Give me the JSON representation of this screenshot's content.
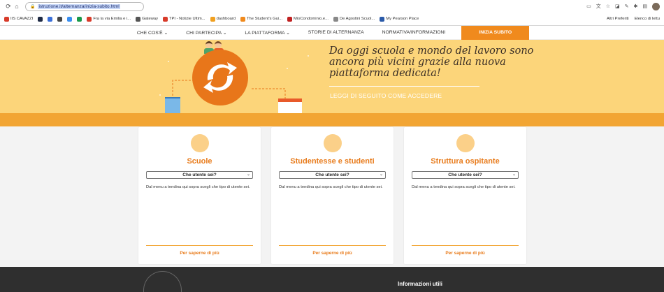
{
  "browser": {
    "url": "istruzione.it/alternanza/inizia-subito.html",
    "bookmarks": [
      {
        "label": "IIS CAVAZZI",
        "color": "#d83b2a"
      },
      {
        "label": "",
        "color": "#1f2a44"
      },
      {
        "label": "",
        "color": "#3a6fd8"
      },
      {
        "label": "",
        "color": "#444"
      },
      {
        "label": "",
        "color": "#3b8ff0"
      },
      {
        "label": "",
        "color": "#1a9a4a"
      },
      {
        "label": "Fra la via Emilia e i...",
        "color": "#d83b2a"
      },
      {
        "label": "Gateway",
        "color": "#555"
      },
      {
        "label": "TPI - Notizie Ultim...",
        "color": "#d83b2a"
      },
      {
        "label": "dashboard",
        "color": "#f0a020"
      },
      {
        "label": "The Student's Gui...",
        "color": "#f08a1d"
      },
      {
        "label": "MioCondominio.e...",
        "color": "#c02020"
      },
      {
        "label": "De Agostini Scuol...",
        "color": "#888"
      },
      {
        "label": "My Pearson Place",
        "color": "#2a5aa8"
      }
    ],
    "bookmarks_right": [
      "Altri Preferiti",
      "Elenco di lettu"
    ]
  },
  "nav": {
    "items": [
      "CHE COS'È ⌄",
      "CHI PARTECIPA ⌄",
      "LA PIATTAFORMA ⌄",
      "STORIE DI ALTERNANZA",
      "NORMATIVA/INFORMAZIONI"
    ],
    "cta": "INIZIA SUBITO"
  },
  "hero": {
    "tagline": "Da oggi scuola e mondo del lavoro sono ancora più vicini grazie alla nuova piattaforma dedicata!",
    "readmore": "LEGGI DI SEGUITO COME ACCEDERE"
  },
  "cards": [
    {
      "title": "Scuole",
      "select": "Che utente sei?",
      "text": "Dal menu a tendina qui sopra scegli che tipo di utente sei.",
      "more": "Per saperne di più"
    },
    {
      "title": "Studentesse e studenti",
      "select": "Che utente sei?",
      "text": "Dal menu a tendina qui sopra scegli che tipo di utente sei.",
      "more": "Per saperne di più"
    },
    {
      "title": "Struttura ospitante",
      "select": "Che utente sei?",
      "text": "Dal menu a tendina qui sopra scegli che tipo di utente sei.",
      "more": "Per saperne di più"
    }
  ],
  "footer": {
    "info": "Informazioni utili"
  },
  "colors": {
    "accent": "#f08a1d",
    "hero": "#fcd57a",
    "band": "#f2a533",
    "footer": "#2f2f2f"
  }
}
